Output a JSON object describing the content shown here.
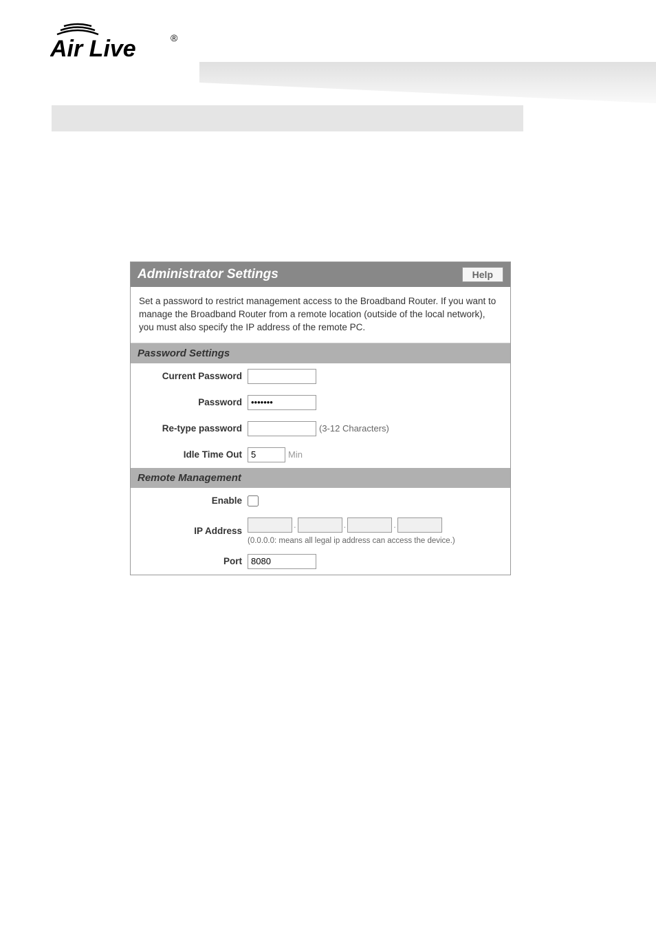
{
  "logo": {
    "text": "Air Live"
  },
  "panel": {
    "title": "Administrator Settings",
    "help_label": "Help",
    "description": "Set a password to restrict management access to the Broadband Router. If you want to manage the Broadband Router from a remote location (outside of the local network), you must also specify the IP address of the remote PC."
  },
  "password_section": {
    "title": "Password Settings",
    "current_password_label": "Current Password",
    "current_password_value": "",
    "password_label": "Password",
    "password_value": "•••••••",
    "retype_label": "Re-type password",
    "retype_value": "",
    "retype_hint": "(3-12 Characters)",
    "idle_label": "Idle Time Out",
    "idle_value": "5",
    "idle_unit": "Min"
  },
  "remote_section": {
    "title": "Remote Management",
    "enable_label": "Enable",
    "enable_checked": false,
    "ip_label": "IP Address",
    "ip_parts": [
      "",
      "",
      "",
      ""
    ],
    "ip_note": "(0.0.0.0: means all legal ip address can access the device.)",
    "port_label": "Port",
    "port_value": "8080"
  }
}
